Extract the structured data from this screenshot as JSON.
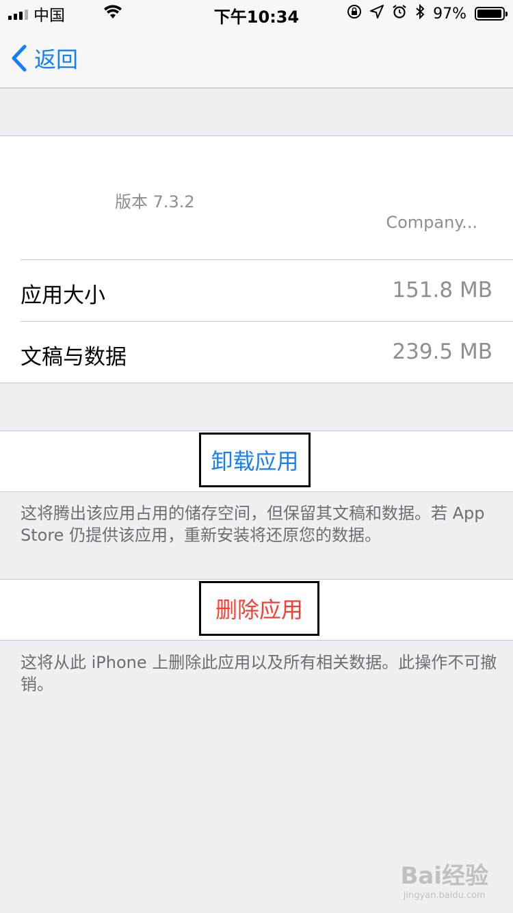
{
  "status_bar": {
    "carrier": "中国",
    "time": "下午10:34",
    "battery_text": "97%",
    "battery_level": 0.97
  },
  "nav": {
    "back_label": "返回"
  },
  "app": {
    "version": "版本 7.3.2",
    "company": "Company...",
    "size_label": "应用大小",
    "size_value": "151.8 MB",
    "docs_label": "文稿与数据",
    "docs_value": "239.5 MB"
  },
  "offload": {
    "label": "卸载应用",
    "note": "这将腾出该应用占用的储存空间，但保留其文稿和数据。若 App Store 仍提供该应用，重新安装将还原您的数据。"
  },
  "delete": {
    "label": "删除应用",
    "note": "这将从此 iPhone 上删除此应用以及所有相关数据。此操作不可撤销。"
  },
  "watermark": {
    "brand": "Bai经验",
    "url": "jingyan.baidu.com"
  },
  "colors": {
    "accent": "#157efb",
    "destructive": "#ff3b30",
    "background": "#efeff4"
  }
}
